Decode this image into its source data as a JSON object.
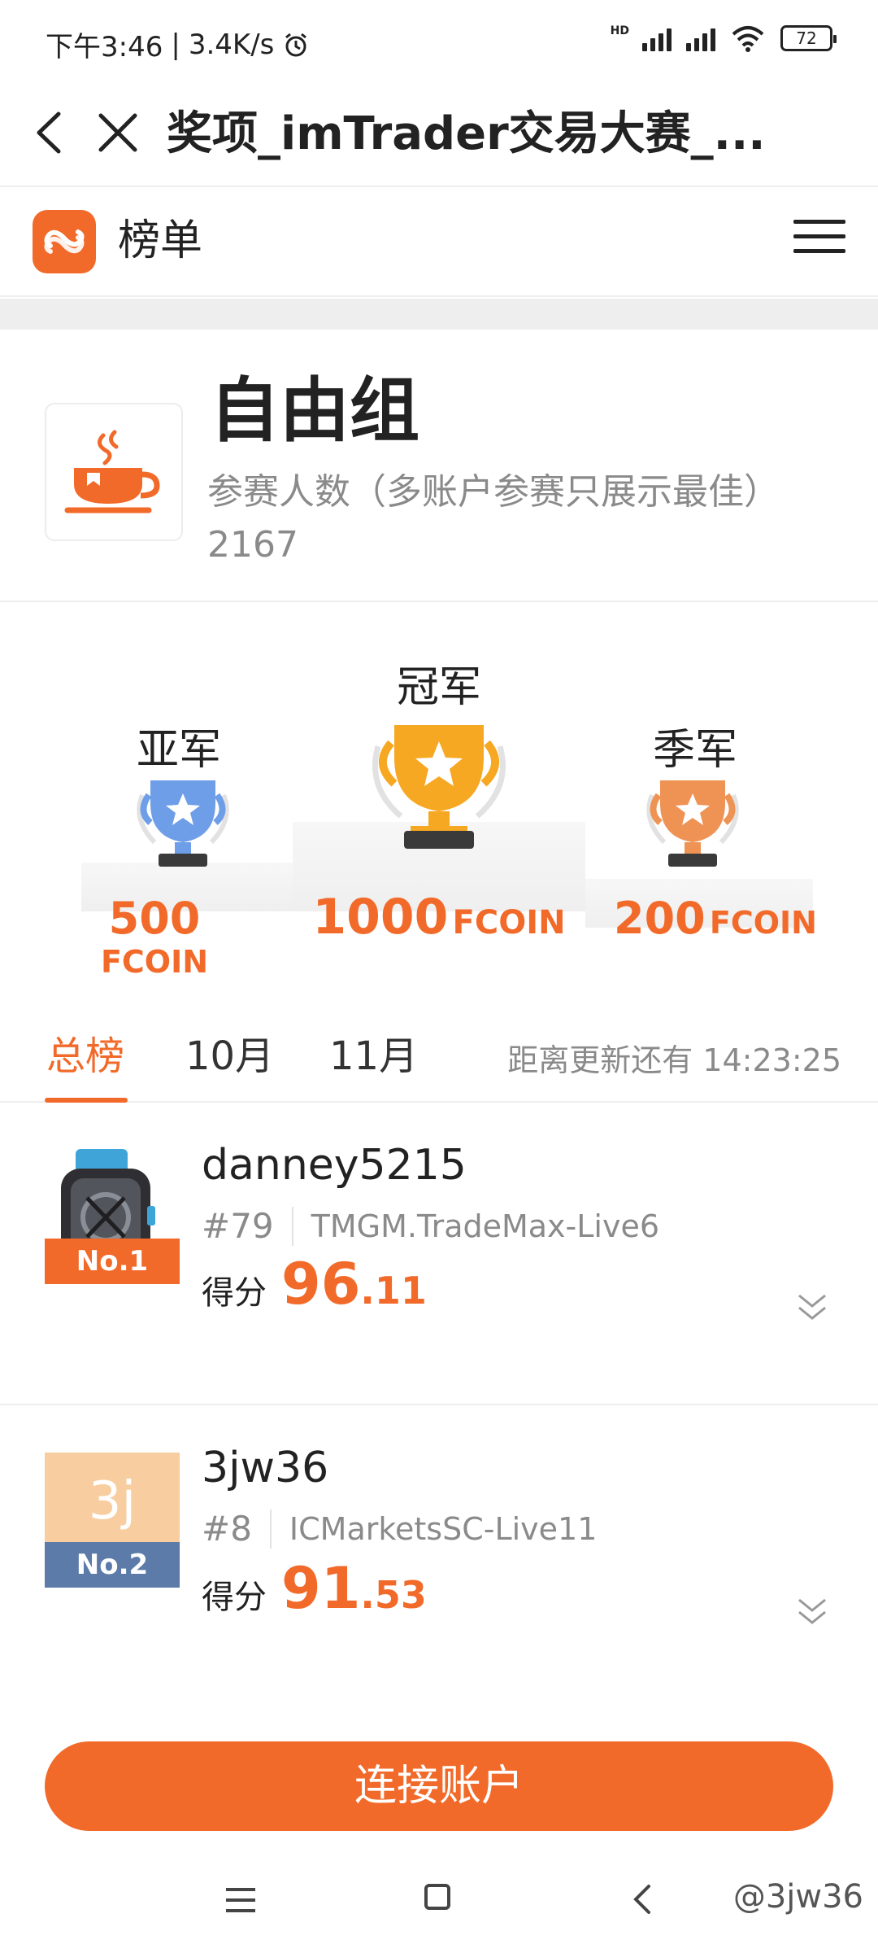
{
  "status_bar": {
    "time": "下午3:46",
    "network_speed": "3.4K/s",
    "hd_label": "HD",
    "battery": "72"
  },
  "nav": {
    "title": "奖项_imTrader交易大赛_..."
  },
  "app_header": {
    "title": "榜单"
  },
  "group": {
    "name": "自由组",
    "participants_label": "参赛人数（多账户参赛只展示最佳）",
    "participants_count": "2167"
  },
  "podium": {
    "second": {
      "title": "亚军",
      "prize": "500",
      "unit": "FCOIN"
    },
    "first": {
      "title": "冠军",
      "prize": "1000",
      "unit": "FCOIN"
    },
    "third": {
      "title": "季军",
      "prize": "200",
      "unit": "FCOIN"
    }
  },
  "tabs": {
    "items": [
      {
        "label": "总榜"
      },
      {
        "label": "10月"
      },
      {
        "label": "11月"
      }
    ],
    "active_index": 0,
    "countdown_label": "距离更新还有",
    "countdown_value": "14:23:25"
  },
  "ranking": [
    {
      "badge": "No.1",
      "badge_color": "#f26a2a",
      "name": "danney5215",
      "rank": "#79",
      "server": "TMGM.TradeMax-Live6",
      "score_label": "得分",
      "score_int": "96",
      "score_dec": ".11"
    },
    {
      "badge": "No.2",
      "badge_color": "#5c7ba8",
      "avatar_text": "3j",
      "name": "3jw36",
      "rank": "#8",
      "server": "ICMarketsSC-Live11",
      "score_label": "得分",
      "score_int": "91",
      "score_dec": ".53"
    }
  ],
  "connect_button": "连接账户",
  "watermark": "@3jw36",
  "colors": {
    "accent": "#f26a2a",
    "gold": "#f7a823",
    "silver": "#6f9ee8",
    "bronze": "#ef9355"
  }
}
